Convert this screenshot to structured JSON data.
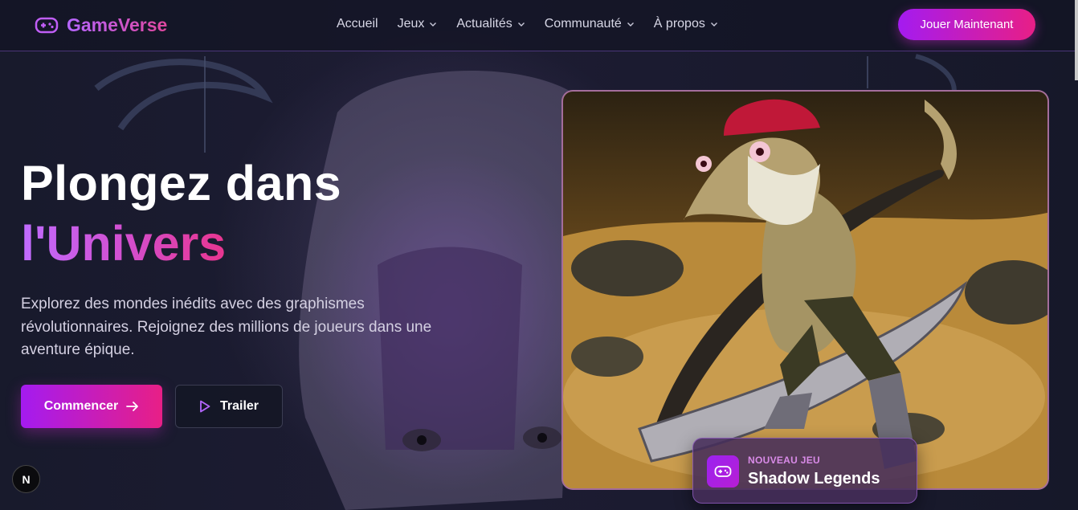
{
  "brand": {
    "name": "GameVerse"
  },
  "nav": {
    "items": [
      {
        "label": "Accueil",
        "has_dropdown": false
      },
      {
        "label": "Jeux",
        "has_dropdown": true
      },
      {
        "label": "Actualités",
        "has_dropdown": true
      },
      {
        "label": "Communauté",
        "has_dropdown": true
      },
      {
        "label": "À propos",
        "has_dropdown": true
      }
    ],
    "cta_label": "Jouer Maintenant"
  },
  "hero": {
    "title_line1": "Plongez dans",
    "title_line2": "l'Univers",
    "description": "Explorez des mondes inédits avec des graphismes révolutionnaires. Rejoignez des millions de joueurs dans une aventure épique.",
    "primary_button": "Commencer",
    "secondary_button": "Trailer"
  },
  "featured": {
    "label": "NOUVEAU JEU",
    "title": "Shadow Legends"
  },
  "badge": {
    "letter": "N"
  },
  "colors": {
    "accent_start": "#a41bf0",
    "accent_end": "#e81f86",
    "background": "#16182a"
  }
}
